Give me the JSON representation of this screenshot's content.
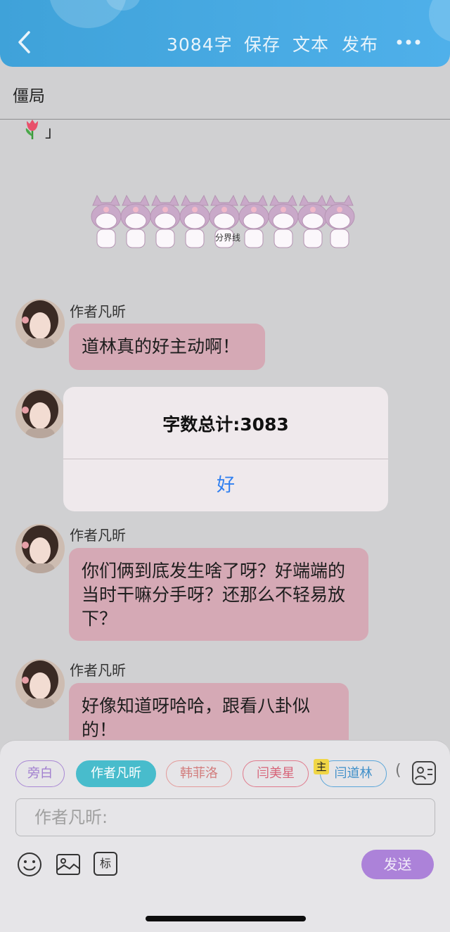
{
  "header": {
    "word_count": "3084字",
    "save": "保存",
    "text": "文本",
    "publish": "发布"
  },
  "title": "僵局",
  "quote_close": "」",
  "divider_label": "分界线",
  "messages": [
    {
      "speaker": "作者凡昕",
      "text": "道林真的好主动啊！"
    },
    {
      "speaker": "作者凡昕",
      "text": "你们俩到底发生啥了呀？好端端的当时干嘛分手呀？还那么不轻易放下？"
    },
    {
      "speaker": "作者凡昕",
      "text": "好像知道呀哈哈，跟看八卦似的！"
    }
  ],
  "alert": {
    "message": "字数总计:3083",
    "ok": "好"
  },
  "characters": [
    "旁白",
    "作者凡昕",
    "韩菲洛",
    "闫美星",
    "闫道林"
  ],
  "character_partial": "(",
  "host_badge": "主",
  "input": {
    "placeholder": "作者凡昕:"
  },
  "tools": {
    "tag_label": "标"
  },
  "send": "发送",
  "colors": {
    "header": "#45a8e2",
    "bubble": "#d5a9b5",
    "selected_chip": "#48bccc",
    "send": "#ac82d9",
    "alert_button": "#2f7ff0"
  }
}
